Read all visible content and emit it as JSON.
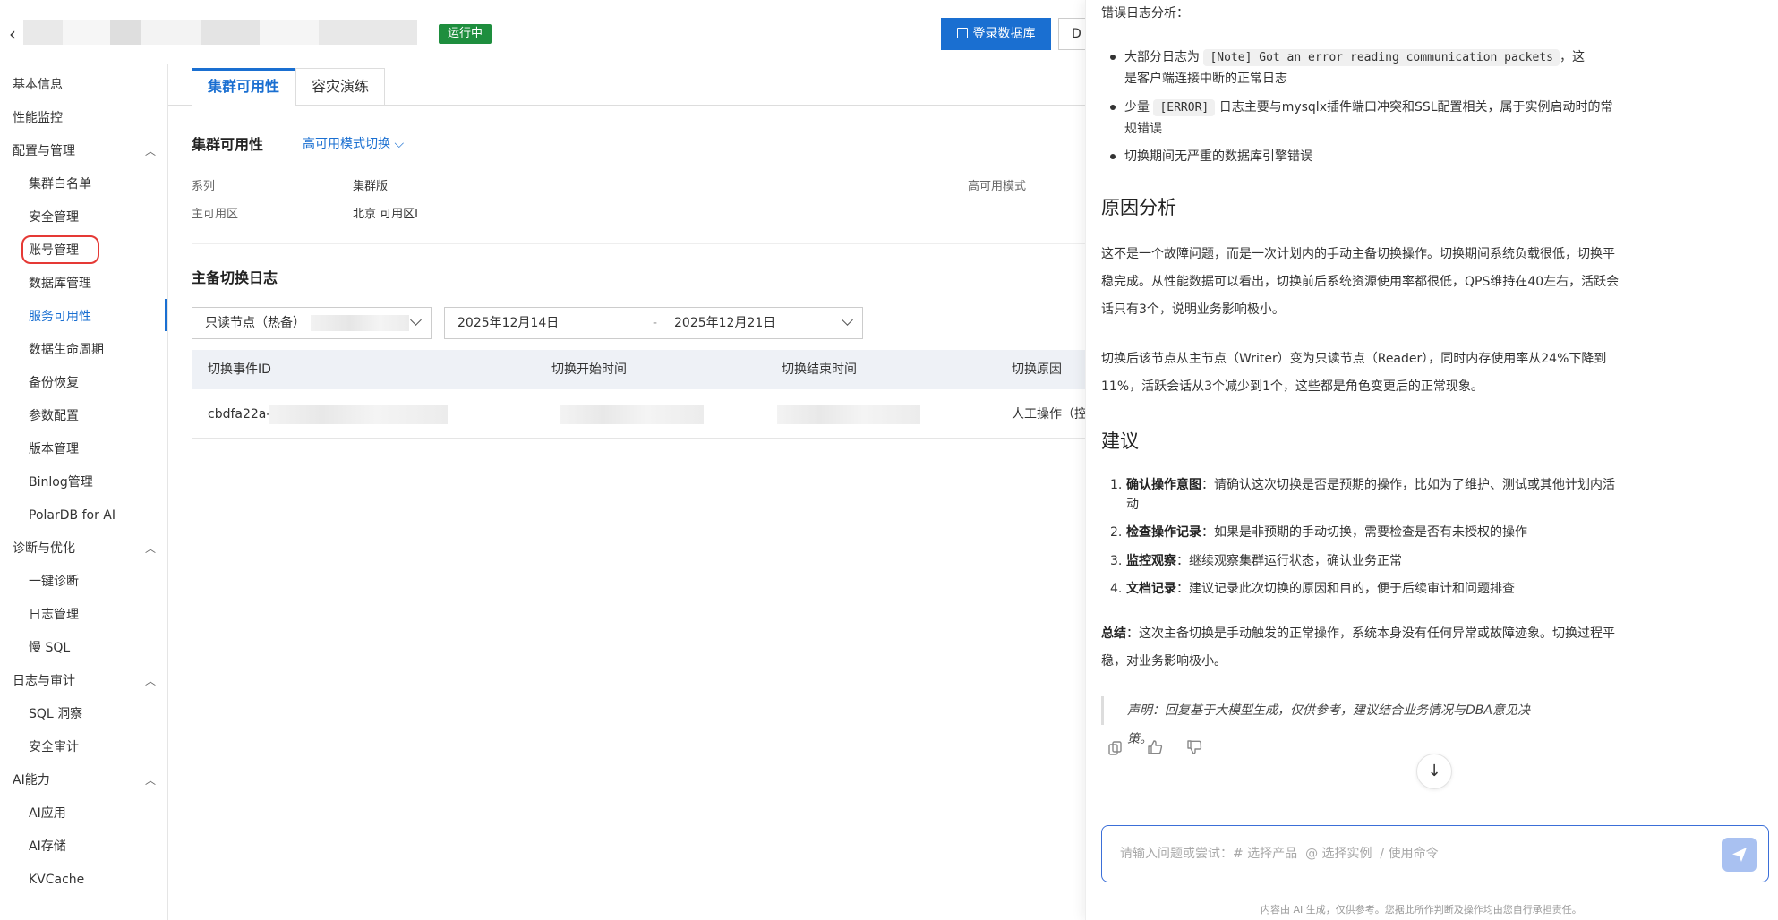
{
  "header": {
    "back_icon": "chevron-left-icon",
    "status": "运行中",
    "login_button": "登录数据库",
    "more_button_partial": "D"
  },
  "sidebar": {
    "items": [
      {
        "label": "基本信息"
      },
      {
        "label": "性能监控"
      }
    ],
    "groups": [
      {
        "label": "配置与管理",
        "items": [
          "集群白名单",
          "安全管理",
          "账号管理",
          "数据库管理",
          "服务可用性",
          "数据生命周期",
          "备份恢复",
          "参数配置",
          "版本管理",
          "Binlog管理",
          "PolarDB for AI"
        ]
      },
      {
        "label": "诊断与优化",
        "items": [
          "一键诊断",
          "日志管理",
          "慢 SQL"
        ]
      },
      {
        "label": "日志与审计",
        "items": [
          "SQL 洞察",
          "安全审计"
        ]
      },
      {
        "label": "AI能力",
        "items": [
          "AI应用",
          "AI存储",
          "KVCache"
        ]
      }
    ],
    "active_item": "服务可用性"
  },
  "tabs": [
    "集群可用性",
    "容灾演练"
  ],
  "availability": {
    "title": "集群可用性",
    "mode_switch": "高可用模式切换",
    "series_label": "系列",
    "series_value": "集群版",
    "zone_label": "主可用区",
    "zone_value": "北京 可用区I",
    "ha_mode_label": "高可用模式"
  },
  "switch_log": {
    "title": "主备切换日志",
    "node_select": "只读节点（热备）",
    "date_start": "2025年12月14日",
    "date_sep": "-",
    "date_end": "2025年12月21日",
    "columns": [
      "切换事件ID",
      "切换开始时间",
      "切换结束时间",
      "切换原因"
    ],
    "rows": [
      {
        "id": "cbdfa22a-",
        "reason": "人工操作（控"
      }
    ]
  },
  "assistant": {
    "error_log_title": "错误日志分析：",
    "bullets": [
      {
        "pre": "大部分日志为",
        "code": "[Note] Got an error reading communication packets",
        "post": "，这",
        "line2": "是客户端连接中断的正常日志"
      },
      {
        "pre": "少量",
        "code": "[ERROR]",
        "post": "日志主要与mysqlx插件端口冲突和SSL配置相关，属于实例启动时的常",
        "line2": "规错误"
      },
      {
        "pre": "切换期间无严重的数据库引擎错误",
        "code": "",
        "post": "",
        "line2": ""
      }
    ],
    "cause_title": "原因分析",
    "cause_p1": [
      "这不是一个故障问题，而是一次计划内的手动主备切换操作。切换期间系统负载很低，切换平",
      "稳完成。从性能数据可以看出，切换前后系统资源使用率都很低，QPS维持在40左右，活跃会",
      "话只有3个，说明业务影响极小。"
    ],
    "cause_p2": [
      "切换后该节点从主节点（Writer）变为只读节点（Reader），同时内存使用率从24%下降到",
      "11%，活跃会话从3个减少到1个，这些都是角色变更后的正常现象。"
    ],
    "advice_title": "建议",
    "advice": [
      {
        "n": "1.",
        "bold": "确认操作意图",
        "text": "：请确认这次切换是否是预期的操作，比如为了维护、测试或其他计划内活",
        "line2": "动"
      },
      {
        "n": "2.",
        "bold": "检查操作记录",
        "text": "：如果是非预期的手动切换，需要检查是否有未授权的操作",
        "line2": ""
      },
      {
        "n": "3.",
        "bold": "监控观察",
        "text": "：继续观察集群运行状态，确认业务正常",
        "line2": ""
      },
      {
        "n": "4.",
        "bold": "文档记录",
        "text": "：建议记录此次切换的原因和目的，便于后续审计和问题排查",
        "line2": ""
      }
    ],
    "summary_bold": "总结",
    "summary_text": "：这次主备切换是手动触发的正常操作，系统本身没有任何异常或故障迹象。切换过程平",
    "summary_line2": "稳，对业务影响极小。",
    "disclaimer": "声明：回复基于大模型生成，仅供参考，建议结合业务情况与DBA意见决策。",
    "input_placeholder": "请输入问题或尝试：# 选择产品  @ 选择实例  / 使用命令",
    "footer": "内容由 AI 生成，仅供参考。您据此所作判断及操作均由您自行承担责任。"
  },
  "colors": {
    "accent": "#1a6fd1",
    "status_green": "#1e8e3e",
    "highlight_red": "#e53935"
  }
}
